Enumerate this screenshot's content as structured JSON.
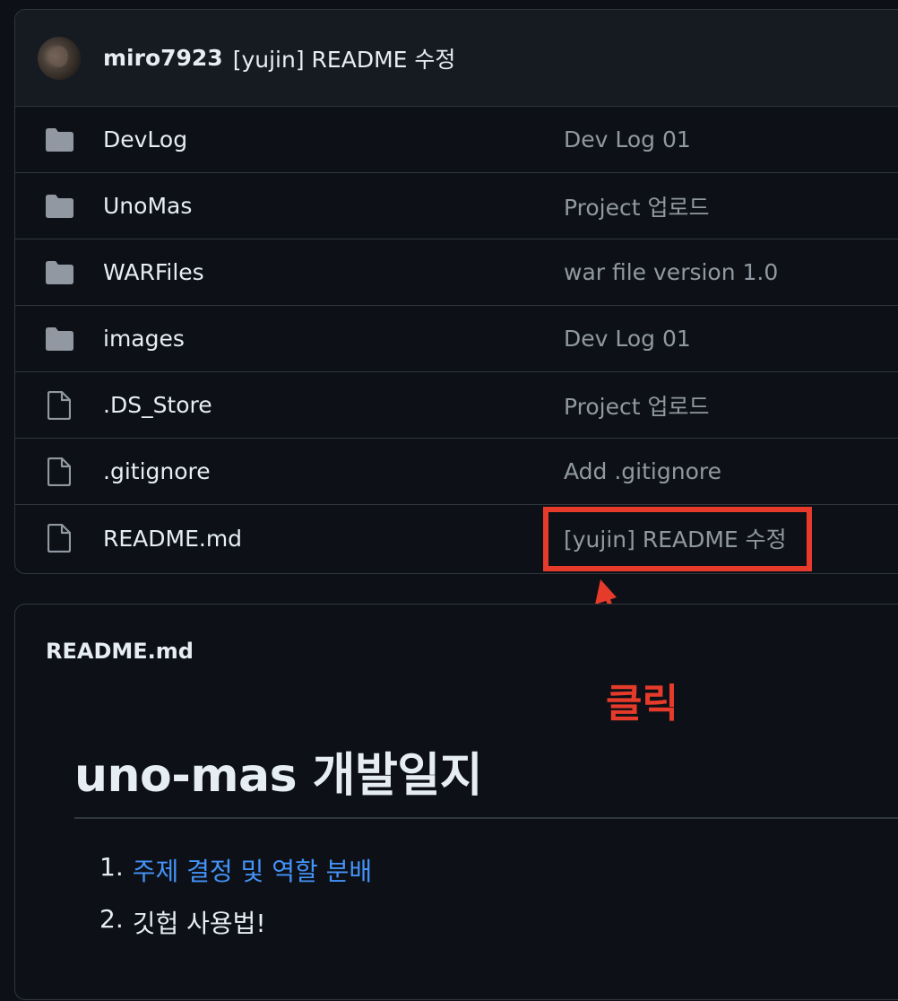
{
  "commit": {
    "author": "miro7923",
    "message": "[yujin] README 수정"
  },
  "files": [
    {
      "name": "DevLog",
      "type": "folder",
      "commit": "Dev Log 01"
    },
    {
      "name": "UnoMas",
      "type": "folder",
      "commit": "Project 업로드"
    },
    {
      "name": "WARFiles",
      "type": "folder",
      "commit": "war file version 1.0"
    },
    {
      "name": "images",
      "type": "folder",
      "commit": "Dev Log 01"
    },
    {
      "name": ".DS_Store",
      "type": "file",
      "commit": "Project 업로드"
    },
    {
      "name": ".gitignore",
      "type": "file",
      "commit": "Add .gitignore"
    },
    {
      "name": "README.md",
      "type": "file",
      "commit": "[yujin] README 수정"
    }
  ],
  "readme": {
    "filename": "README.md",
    "heading": "uno-mas 개발일지",
    "list": [
      {
        "num": "1.",
        "text": "주제 결정 및 역할 분배"
      },
      {
        "num": "2.",
        "text": "깃헙 사용법!"
      }
    ]
  },
  "annotation": {
    "label": "클릭",
    "color": "#e63b2a"
  },
  "colors": {
    "background": "#0d1117",
    "header_bg": "#161b22",
    "border": "#30363d",
    "text": "#e6edf3",
    "muted": "#9198a1",
    "link": "#4493f8",
    "icon": "#9198a1"
  }
}
